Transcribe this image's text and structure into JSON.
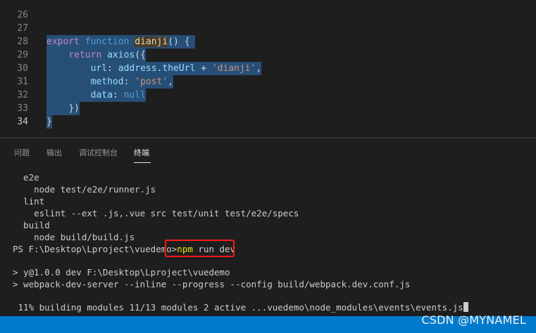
{
  "editor": {
    "lines": [
      {
        "num": "26"
      },
      {
        "num": "27",
        "kw": "export",
        "kw2": "function",
        "fn": "dianji",
        "rest": "() {"
      },
      {
        "num": "28",
        "kw": "return",
        "obj": "axios",
        "rest": "({"
      },
      {
        "num": "29",
        "key": "url",
        "obj": "address",
        "prop": "theUrl",
        "op": "+",
        "str": "'dianji'",
        "rest": ","
      },
      {
        "num": "30",
        "key": "method",
        "str": "'post'",
        "rest": ","
      },
      {
        "num": "31",
        "key": "data",
        "val": "null"
      },
      {
        "num": "32",
        "text": "})"
      },
      {
        "num": "33",
        "text": "}"
      },
      {
        "num": "34"
      }
    ]
  },
  "panel": {
    "tabs": [
      {
        "label": "问题"
      },
      {
        "label": "输出"
      },
      {
        "label": "调试控制台"
      },
      {
        "label": "终端"
      }
    ]
  },
  "terminal": {
    "lines": [
      "  e2e",
      "    node test/e2e/runner.js",
      "  lint",
      "    eslint --ext .js,.vue src test/unit test/e2e/specs",
      "  build",
      "    node build/build.js"
    ],
    "prompt": "PS F:\\Desktop\\Lproject\\vuedemo>",
    "cmd_npm": "npm",
    "cmd_rest": "run dev",
    "output": [
      "> y@1.0.0 dev F:\\Desktop\\Lproject\\vuedemo",
      "> webpack-dev-server --inline --progress --config build/webpack.dev.conf.js"
    ],
    "progress": " 11% building modules 11/13 modules 2 active ...vuedemo\\node_modules\\events\\events.js"
  },
  "watermark": "CSDN @MYNAMEL",
  "colors": {
    "status_bar": "#007acc",
    "highlight_box": "#ff1a1a",
    "npm_text": "#e5e510"
  }
}
